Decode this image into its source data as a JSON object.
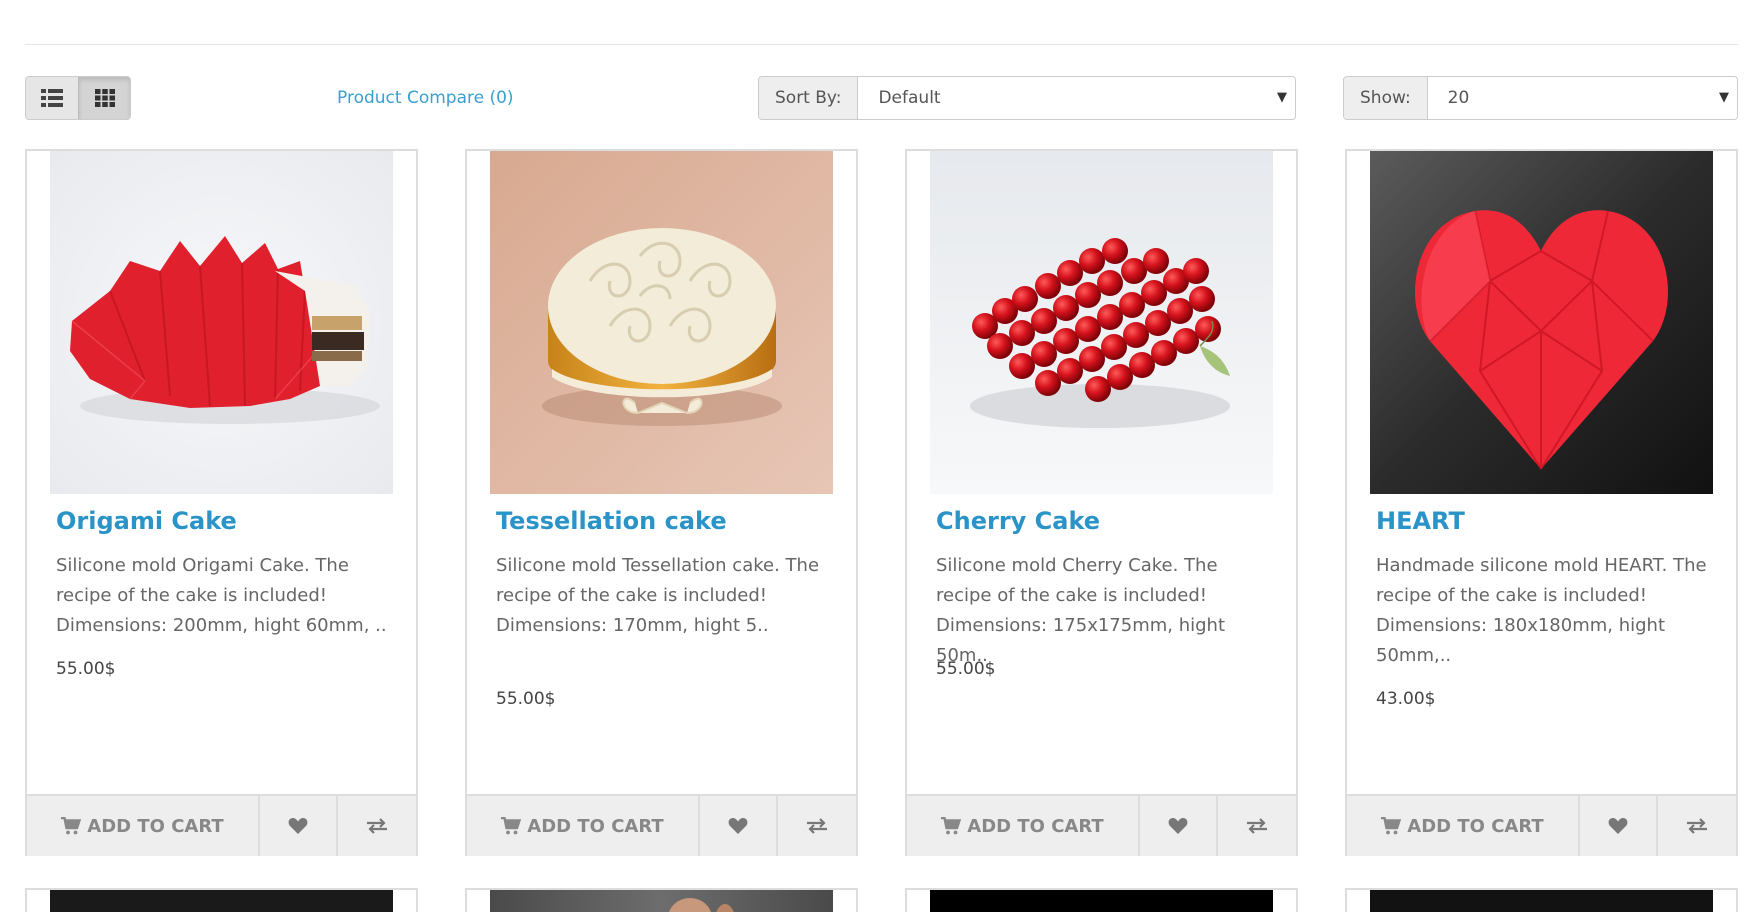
{
  "toolbar": {
    "compare_label": "Product Compare (0)",
    "sort_label": "Sort By:",
    "sort_value": "Default",
    "show_label": "Show:",
    "show_value": "20",
    "caret": "▼"
  },
  "products": [
    {
      "name": "Origami Cake",
      "description": "Silicone mold Origami Cake. The recipe of the cake is included! Dimensions: 200mm, hight 60mm, ..",
      "price": "55.00$",
      "cart_label": "ADD TO CART"
    },
    {
      "name": "Tessellation cake",
      "description": "Silicone mold Tessellation cake. The recipe of the cake is included! Dimensions: 170mm, hight 5..",
      "price": "55.00$",
      "cart_label": "ADD TO CART"
    },
    {
      "name": "Cherry Cake",
      "description": "Silicone mold Cherry Cake. The recipe of the cake is included! Dimensions: 175x175mm, hight 50m..",
      "price": "55.00$",
      "cart_label": "ADD TO CART"
    },
    {
      "name": "HEART",
      "description": "Handmade silicone mold HEART. The recipe of the cake is included! Dimensions: 180x180mm, hight 50mm,..",
      "price": "43.00$",
      "cart_label": "ADD TO CART"
    }
  ],
  "colors": {
    "link": "#2a93c8",
    "compare_link": "#3a9fd1",
    "button_bg": "#eeeeee",
    "border": "#dddddd"
  },
  "icons": {
    "list_view": "list-icon",
    "grid_view": "grid-icon",
    "cart": "shopping-cart-icon",
    "wishlist": "heart-icon",
    "compare": "exchange-icon"
  }
}
